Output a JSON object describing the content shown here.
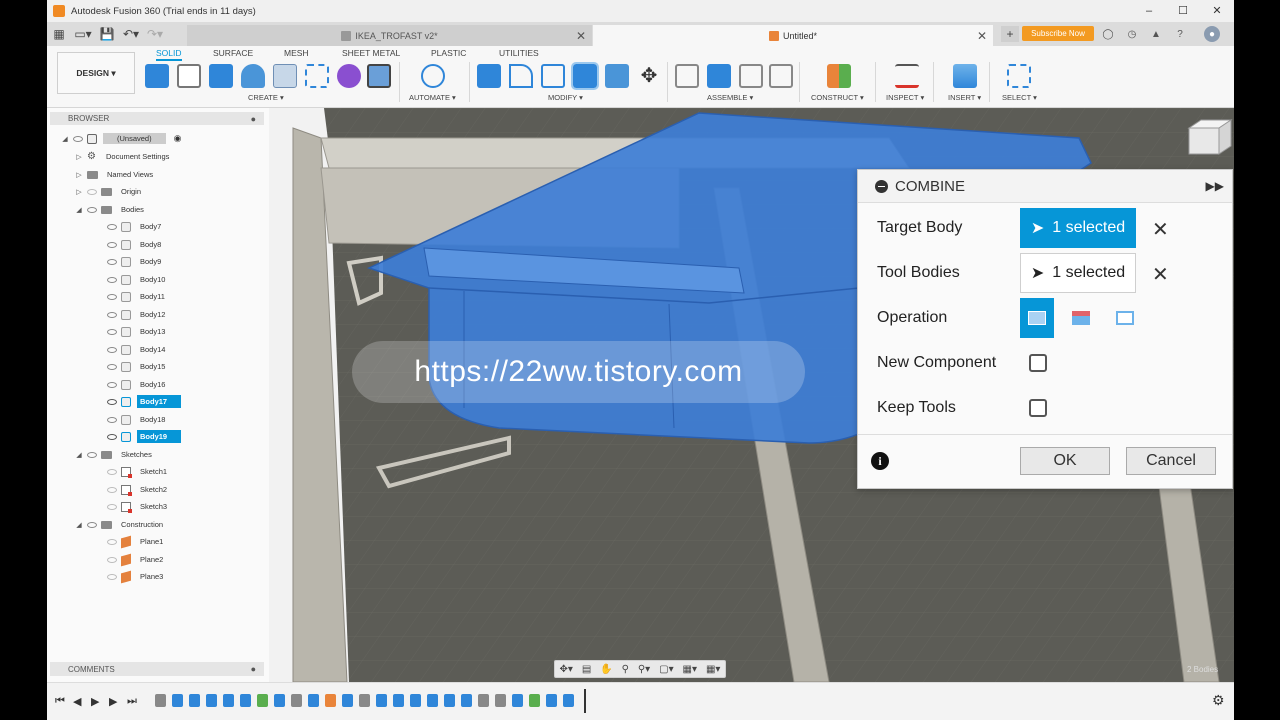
{
  "window": {
    "title": "Autodesk Fusion 360 (Trial ends in 11 days)"
  },
  "tabs": [
    {
      "label": "IKEA_TROFAST v2*"
    },
    {
      "label": "Untitled*"
    }
  ],
  "header": {
    "subscribe_label": "Subscribe Now"
  },
  "ribbon": {
    "workspace": "DESIGN ▾",
    "tabs": [
      "SOLID",
      "SURFACE",
      "MESH",
      "SHEET METAL",
      "PLASTIC",
      "UTILITIES"
    ],
    "groups": [
      "CREATE ▾",
      "AUTOMATE ▾",
      "MODIFY ▾",
      "ASSEMBLE ▾",
      "CONSTRUCT ▾",
      "INSPECT ▾",
      "INSERT ▾",
      "SELECT ▾"
    ]
  },
  "browser": {
    "title": "BROWSER",
    "root": "(Unsaved)",
    "items": [
      {
        "label": "Document Settings",
        "kind": "settings"
      },
      {
        "label": "Named Views",
        "kind": "folder"
      },
      {
        "label": "Origin",
        "kind": "folder"
      },
      {
        "label": "Bodies",
        "kind": "folder"
      }
    ],
    "bodies": [
      "Body7",
      "Body8",
      "Body9",
      "Body10",
      "Body11",
      "Body12",
      "Body13",
      "Body14",
      "Body15",
      "Body16",
      "Body17",
      "Body18",
      "Body19"
    ],
    "sketches_label": "Sketches",
    "sketches": [
      "Sketch1",
      "Sketch2",
      "Sketch3"
    ],
    "construction_label": "Construction",
    "planes": [
      "Plane1",
      "Plane2",
      "Plane3"
    ],
    "comments_label": "COMMENTS"
  },
  "combine_dialog": {
    "title": "COMBINE",
    "target_label": "Target Body",
    "target_value": "1 selected",
    "tool_label": "Tool Bodies",
    "tool_value": "1 selected",
    "operation_label": "Operation",
    "new_component_label": "New Component",
    "keep_tools_label": "Keep Tools",
    "ok_label": "OK",
    "cancel_label": "Cancel"
  },
  "viewport": {
    "bodies_count": "2 Bodies",
    "watermark": "https://22ww.tistory.com"
  },
  "colors": {
    "accent": "#0696d7",
    "selected_body": "#3f7fd6",
    "subscribe": "#f39a21"
  }
}
